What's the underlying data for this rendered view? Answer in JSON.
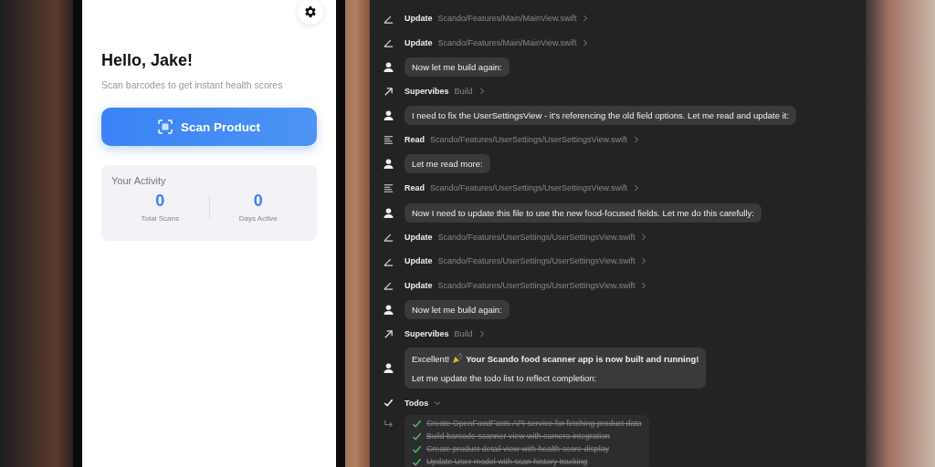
{
  "phone": {
    "greeting": "Hello, Jake!",
    "subtitle": "Scan barcodes to get instant health scores",
    "scan_button": "Scan Product",
    "activity": {
      "title": "Your Activity",
      "stats": [
        {
          "value": "0",
          "label": "Total Scans"
        },
        {
          "value": "0",
          "label": "Days Active"
        }
      ]
    }
  },
  "chat": [
    {
      "kind": "edit",
      "action": "Update",
      "target": "Scando/Features/Main/MainView.swift"
    },
    {
      "kind": "edit",
      "action": "Update",
      "target": "Scando/Features/Main/MainView.swift"
    },
    {
      "kind": "message",
      "text": "Now let me build again:"
    },
    {
      "kind": "tool",
      "action": "Supervibes",
      "target": "Build"
    },
    {
      "kind": "message",
      "text": "I need to fix the UserSettingsView - it's referencing the old field options. Let me read and update it:"
    },
    {
      "kind": "read",
      "action": "Read",
      "target": "Scando/Features/UserSettings/UserSettingsView.swift"
    },
    {
      "kind": "message",
      "text": "Let me read more:"
    },
    {
      "kind": "read",
      "action": "Read",
      "target": "Scando/Features/UserSettings/UserSettingsView.swift"
    },
    {
      "kind": "message",
      "text": "Now I need to update this file to use the new food-focused fields. Let me do this carefully:"
    },
    {
      "kind": "edit",
      "action": "Update",
      "target": "Scando/Features/UserSettings/UserSettingsView.swift"
    },
    {
      "kind": "edit",
      "action": "Update",
      "target": "Scando/Features/UserSettings/UserSettingsView.swift"
    },
    {
      "kind": "edit",
      "action": "Update",
      "target": "Scando/Features/UserSettings/UserSettingsView.swift"
    },
    {
      "kind": "message",
      "text": "Now let me build again:"
    },
    {
      "kind": "tool",
      "action": "Supervibes",
      "target": "Build"
    },
    {
      "kind": "celebration",
      "lead": "Excellent!",
      "text": "Your Scando food scanner app is now built and running!",
      "note": "Let me update the todo list to reflect completion:"
    },
    {
      "kind": "todos",
      "action": "Todos",
      "expanded": true,
      "items": [
        {
          "text": "Create OpenFoodFacts API service for fetching product data",
          "done": true
        },
        {
          "text": "Build barcode scanner view with camera integration",
          "done": true
        },
        {
          "text": "Create product detail view with health score display",
          "done": true
        },
        {
          "text": "Update User model with scan history tracking",
          "done": true
        }
      ]
    }
  ]
}
